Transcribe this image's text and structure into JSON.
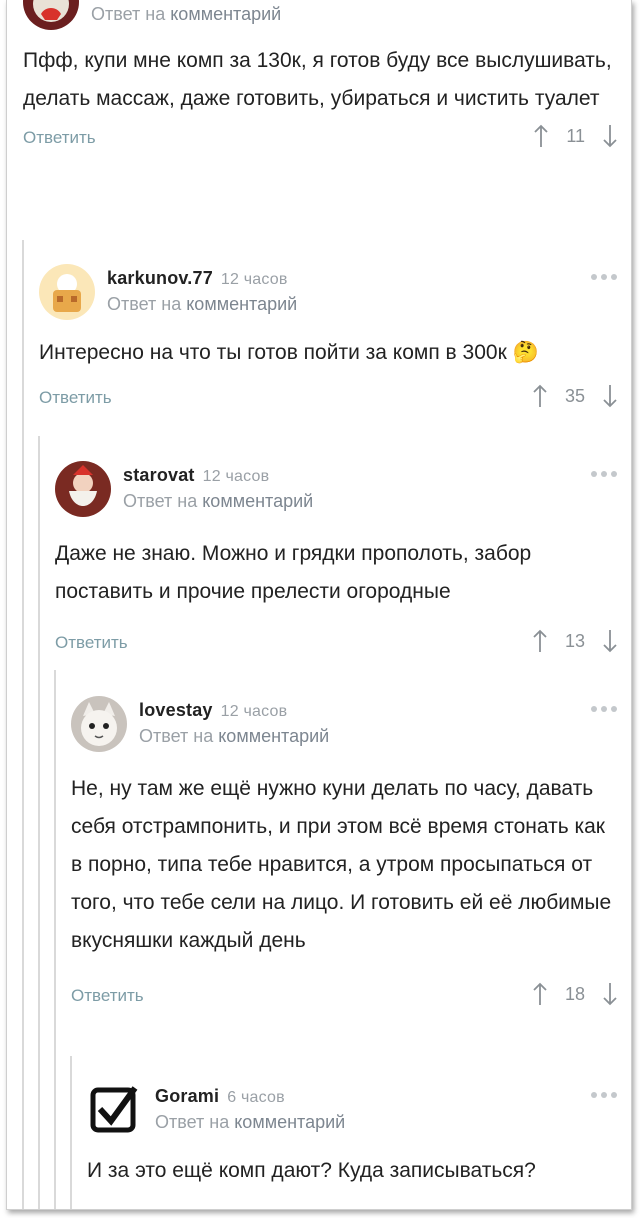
{
  "reply_prefix": "Ответ на",
  "reply_target": "комментарий",
  "reply_button": "Ответить",
  "comments": [
    {
      "username": "",
      "time": "",
      "text": "Пфф, купи мне комп за 130к, я готов буду все выслушивать, делать массаж, даже готовить, убираться и чистить туалет",
      "score": "11"
    },
    {
      "username": "karkunov.77",
      "time": "12 часов",
      "text": "Интересно на что ты готов пойти за комп в 300к 🤔",
      "score": "35"
    },
    {
      "username": "starovat",
      "time": "12 часов",
      "text": "Даже не знаю. Можно и грядки прополоть, забор поставить и прочие прелести огородные",
      "score": "13"
    },
    {
      "username": "lovestay",
      "time": "12 часов",
      "text": "Не, ну там же ещё нужно куни делать по часу, давать себя отстрампонить, и при этом всё время стонать как в порно, типа тебе нравится, а утром просыпаться от того, что тебе сели на лицо. И готовить ей её любимые вкусняшки каждый день",
      "score": "18"
    },
    {
      "username": "Gorami",
      "time": "6 часов",
      "text": "И за это ещё комп дают? Куда записываться?",
      "score": ""
    }
  ],
  "icons": {
    "upvote": "arrow-up-icon",
    "downvote": "arrow-down-icon",
    "more": "more-dots-icon"
  },
  "colors": {
    "link": "#7d9ca6",
    "muted": "#9aa0a6",
    "thread_line": "#d9d9d9"
  }
}
